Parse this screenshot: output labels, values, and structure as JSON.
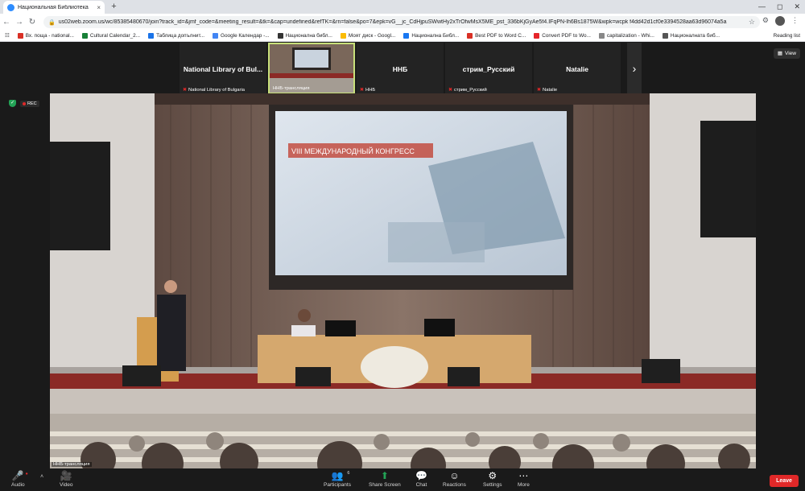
{
  "browser": {
    "tab_title": "Национальная Библиотека",
    "tab_close": "×",
    "new_tab": "+",
    "url": "us02web.zoom.us/wc/85385480670/join?track_id=&jmf_code=&meeting_result=&tk=&cap=undefined&refTK=&rn=false&po=7&epk=vG__jc_CdHjpuSWwtHy2xTrOfwMsX5ME_pst_336bKjGyAe5f4.IFqPN-lh6Bs1875W&wpk=wcpk f4dd42d1cf0e3394528aa63d96074a5a",
    "bookmarks": [
      {
        "label": "Вх. поща - national...",
        "color": "#d93025"
      },
      {
        "label": "Cultural Calendar_2...",
        "color": "#188038"
      },
      {
        "label": "Таблица допълнит...",
        "color": "#1a73e8"
      },
      {
        "label": "Google Календар -...",
        "color": "#4285f4"
      },
      {
        "label": "Национална библ...",
        "color": "#333333"
      },
      {
        "label": "Моят диск - Googl...",
        "color": "#fbbc04"
      },
      {
        "label": "Национална Библ...",
        "color": "#1877f2"
      },
      {
        "label": "Best PDF to Word C...",
        "color": "#d93025"
      },
      {
        "label": "Convert PDF to Wo...",
        "color": "#e5252a"
      },
      {
        "label": "capitalization - Whi...",
        "color": "#888888"
      },
      {
        "label": "Националната биб...",
        "color": "#555555"
      }
    ],
    "reading_list": "Reading list"
  },
  "zoom": {
    "thumbnails": [
      {
        "name": "National Library of Bul...",
        "label": "National Library of Bulgaria",
        "muted": true,
        "active": false,
        "video": false
      },
      {
        "name": "",
        "label": "ННБ-трансляция",
        "muted": false,
        "active": true,
        "video": true
      },
      {
        "name": "ННБ",
        "label": "ННБ",
        "muted": true,
        "active": false,
        "video": false
      },
      {
        "name": "стрим_Русский",
        "label": "стрим_Русский",
        "muted": true,
        "active": false,
        "video": false
      },
      {
        "name": "Natalie",
        "label": "Natalie",
        "muted": true,
        "active": false,
        "video": false
      }
    ],
    "next_arrow": "›",
    "view_button": "View",
    "rec_label": "REC",
    "stage_name": "ННБ-трансляция",
    "screen_title": "VIII МЕЖДУНАРОДНЫЙ КОНГРЕСС",
    "toolbar": {
      "audio": "Audio",
      "video": "Video",
      "participants": "Participants",
      "participant_count": "6",
      "share": "Share Screen",
      "chat": "Chat",
      "reactions": "Reactions",
      "settings": "Settings",
      "more": "More",
      "leave": "Leave"
    }
  }
}
